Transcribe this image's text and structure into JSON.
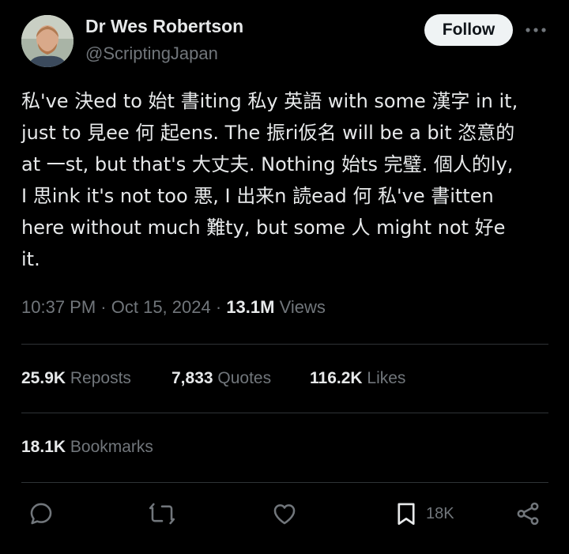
{
  "author": {
    "display_name": "Dr Wes Robertson",
    "handle": "@ScriptingJapan"
  },
  "header": {
    "follow_label": "Follow",
    "more_icon": "more-horizontal-icon"
  },
  "tweet": {
    "lines": [
      "私've 決ed to 始t 書iting 私y 英語 with some 漢字 in it,",
      "just to 見ee 何 起ens. The 振ri仮名 will be a bit 恣意的",
      "at 一st, but that's 大丈夫. Nothing 始ts 完璧. 個人的ly,",
      "I 思ink it's not too 悪, I 出来n 読ead 何 私've 書itten",
      "here without much 難ty, but some 人 might not 好e",
      "it."
    ]
  },
  "meta": {
    "time": "10:37 PM",
    "separator": "·",
    "date": "Oct 15, 2024",
    "separator2": "·",
    "views_count": "13.1M",
    "views_label": "Views"
  },
  "stats": {
    "reposts_count": "25.9K",
    "reposts_label": "Reposts",
    "quotes_count": "7,833",
    "quotes_label": "Quotes",
    "likes_count": "116.2K",
    "likes_label": "Likes",
    "bookmarks_count": "18.1K",
    "bookmarks_label": "Bookmarks"
  },
  "actions": {
    "reply_icon": "reply-icon",
    "repost_icon": "repost-icon",
    "like_icon": "heart-icon",
    "bookmark_icon": "bookmark-icon",
    "bookmark_count": "18K",
    "share_icon": "share-icon"
  },
  "colors": {
    "background": "#000000",
    "primary_text": "#e7e9ea",
    "secondary_text": "#71767b",
    "divider": "#2f3336",
    "follow_bg": "#eff3f4"
  }
}
